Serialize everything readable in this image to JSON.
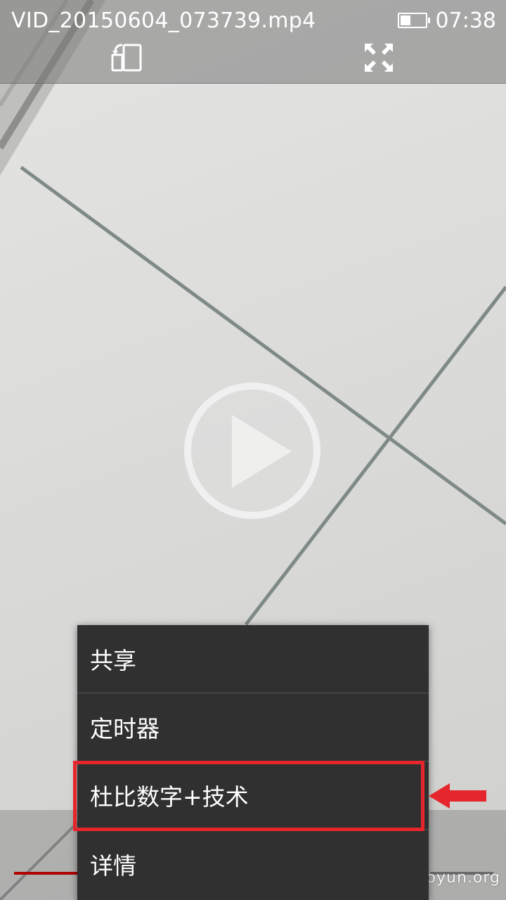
{
  "status_bar": {
    "file_title": "VID_20150604_073739.mp4",
    "time": "07:38"
  },
  "toolbar": {
    "rotate_icon": "rotate-screen-icon",
    "fullscreen_icon": "fullscreen-icon"
  },
  "player": {
    "play_icon": "play-icon"
  },
  "context_menu": {
    "items": [
      {
        "label": "共享"
      },
      {
        "label": "定时器"
      },
      {
        "label": "杜比数字+技术"
      },
      {
        "label": "详情"
      }
    ]
  },
  "watermark": "www.wooyun.org",
  "colors": {
    "highlight": "#e5262c",
    "menu_bg": "#303030",
    "progress": "#b00000"
  }
}
